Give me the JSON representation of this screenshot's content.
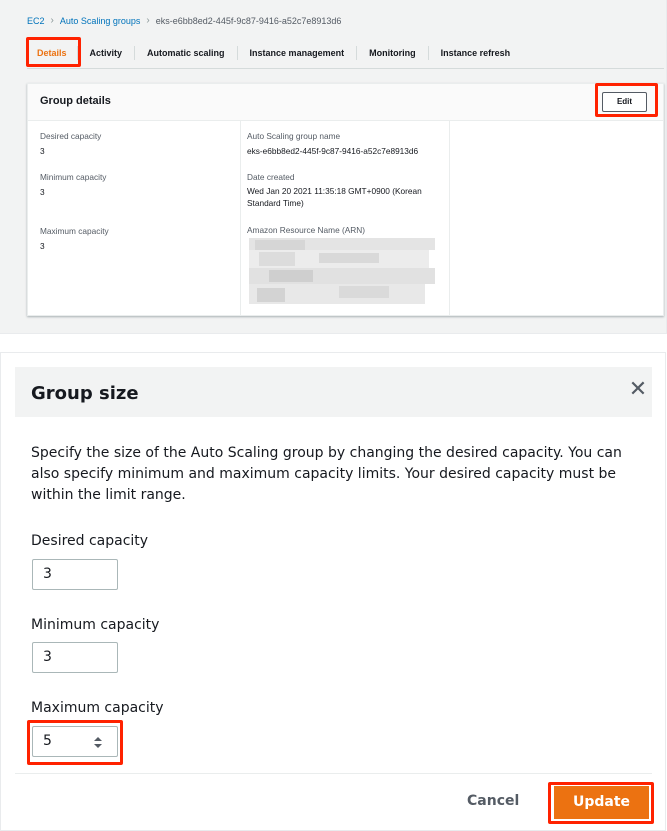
{
  "breadcrumb": {
    "items": [
      "EC2",
      "Auto Scaling groups",
      "eks-e6bb8ed2-445f-9c87-9416-a52c7e8913d6"
    ]
  },
  "tabs": [
    "Details",
    "Activity",
    "Automatic scaling",
    "Instance management",
    "Monitoring",
    "Instance refresh"
  ],
  "active_tab": "Details",
  "group_details": {
    "title": "Group details",
    "edit_label": "Edit",
    "desired_capacity_label": "Desired capacity",
    "desired_capacity_value": "3",
    "minimum_capacity_label": "Minimum capacity",
    "minimum_capacity_value": "3",
    "maximum_capacity_label": "Maximum capacity",
    "maximum_capacity_value": "3",
    "asg_name_label": "Auto Scaling group name",
    "asg_name_value": "eks-e6bb8ed2-445f-9c87-9416-a52c7e8913d6",
    "date_created_label": "Date created",
    "date_created_line1": "Wed Jan 20 2021 11:35:18 GMT+0900 (Korean",
    "date_created_line2": "Standard Time)",
    "arn_label": "Amazon Resource Name (ARN)"
  },
  "modal": {
    "title": "Group size",
    "close_icon": "close-icon",
    "description": "Specify the size of the Auto Scaling group by changing the desired capacity. You can also specify minimum and maximum capacity limits. Your desired capacity must be within the limit range.",
    "desired_label": "Desired capacity",
    "desired_value": "3",
    "minimum_label": "Minimum capacity",
    "minimum_value": "3",
    "maximum_label": "Maximum capacity",
    "maximum_value": "5",
    "cancel_label": "Cancel",
    "update_label": "Update"
  },
  "colors": {
    "accent": "#ec7211",
    "link": "#0073bb",
    "highlight": "#ff2200"
  }
}
